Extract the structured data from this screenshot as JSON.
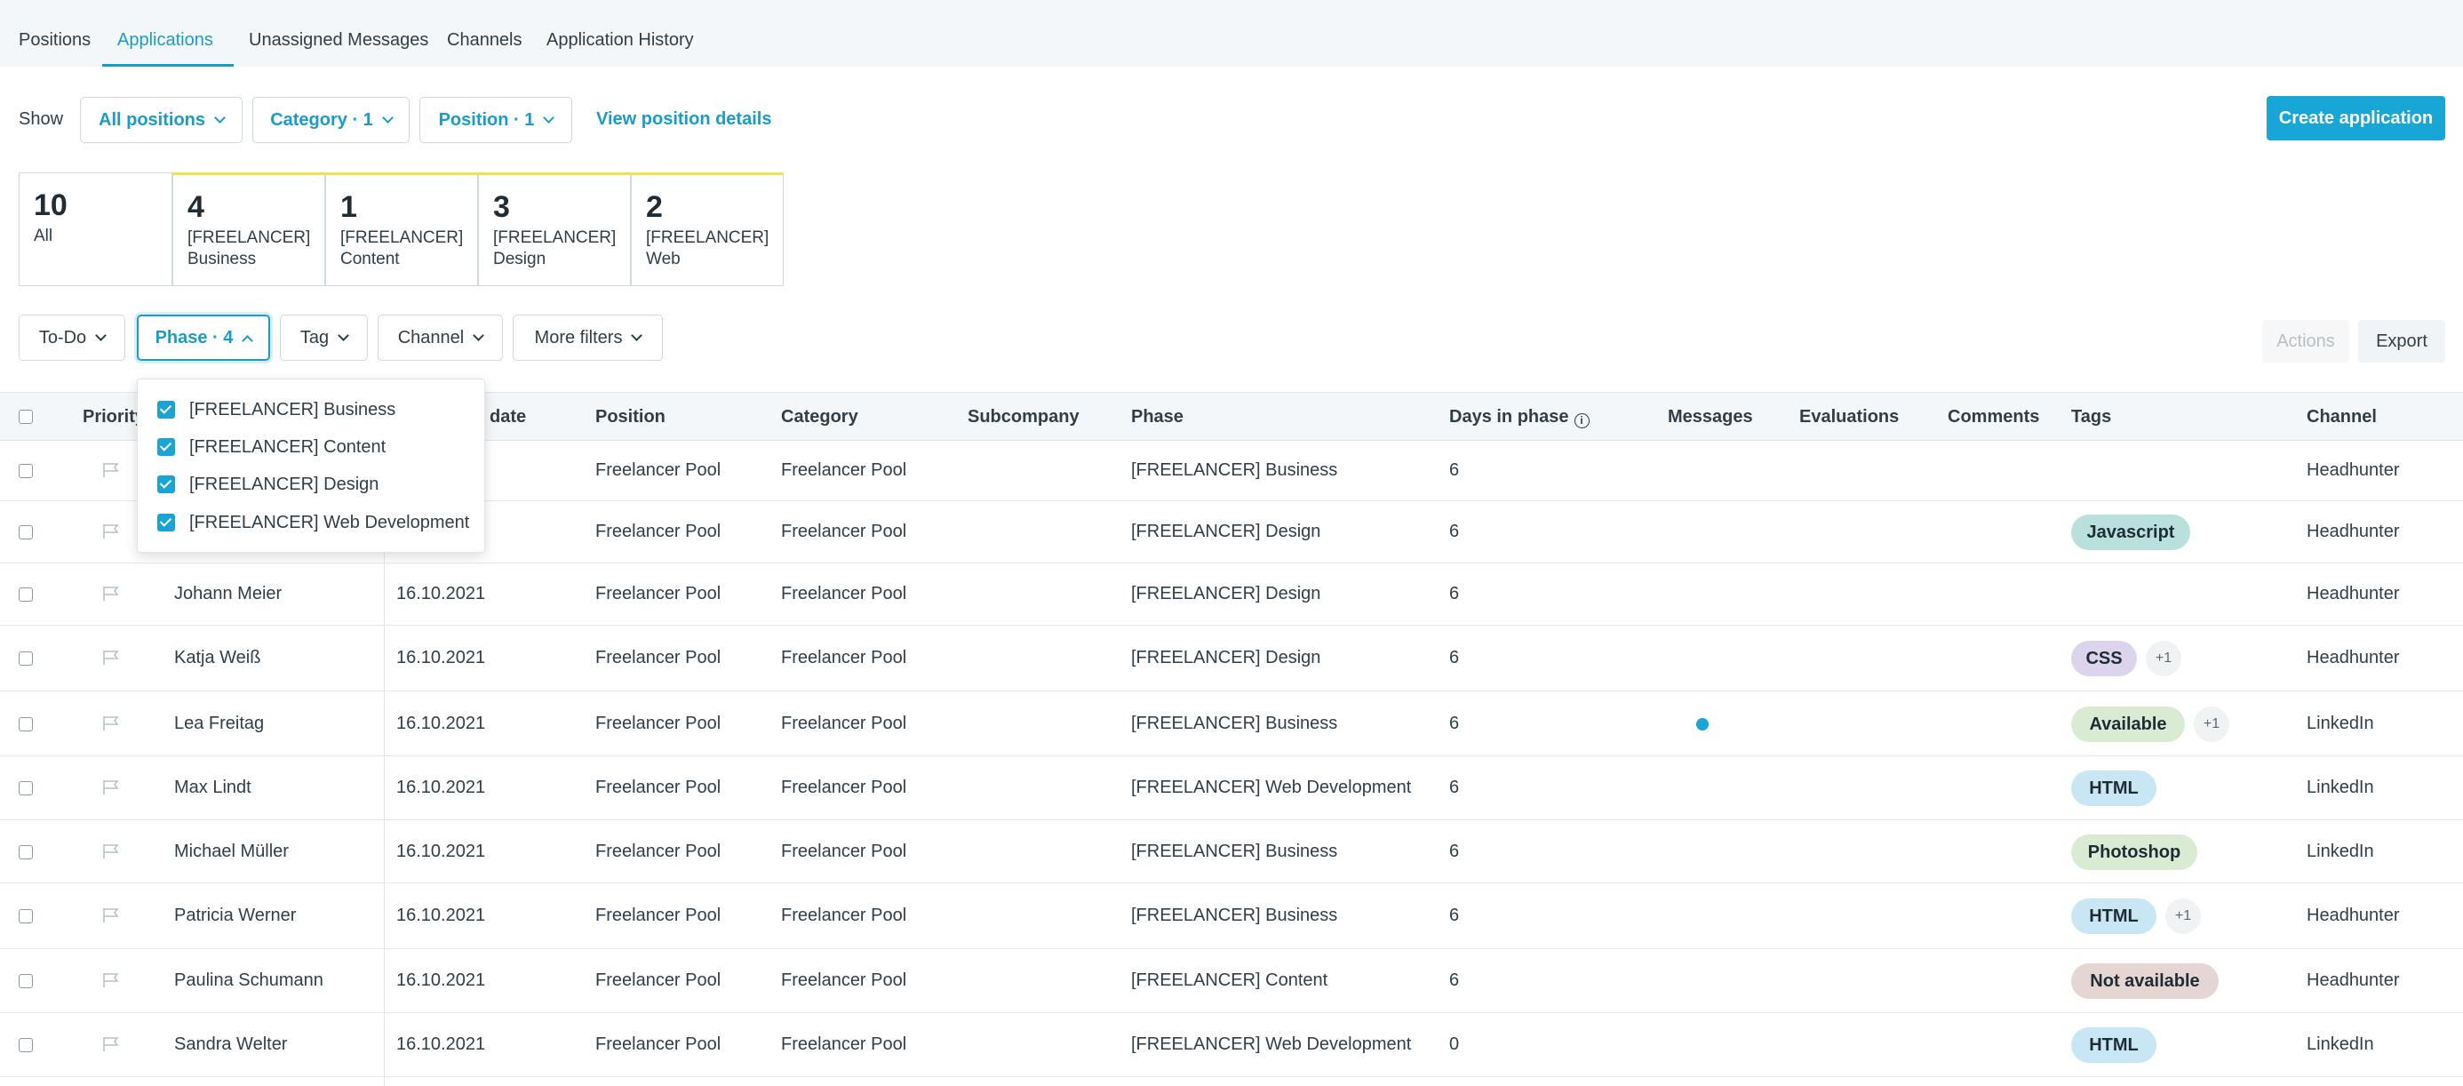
{
  "nav": {
    "tabs": [
      {
        "label": "Positions"
      },
      {
        "label": "Applications"
      },
      {
        "label": "Unassigned Messages"
      },
      {
        "label": "Channels"
      },
      {
        "label": "Application History"
      }
    ]
  },
  "show_bar": {
    "label": "Show",
    "all_positions": "All positions",
    "category": "Category · 1",
    "position": "Position · 1",
    "view_details": "View position details",
    "create": "Create application"
  },
  "cards": [
    {
      "count": "10",
      "line1": "All",
      "line2": ""
    },
    {
      "count": "4",
      "line1": "[FREELANCER]",
      "line2": "Business"
    },
    {
      "count": "1",
      "line1": "[FREELANCER]",
      "line2": "Content"
    },
    {
      "count": "3",
      "line1": "[FREELANCER]",
      "line2": "Design"
    },
    {
      "count": "2",
      "line1": "[FREELANCER]",
      "line2": "Web"
    }
  ],
  "filters": {
    "todo": "To-Do",
    "phase": "Phase · 4",
    "tag": "Tag",
    "channel": "Channel",
    "more": "More filters",
    "actions": "Actions",
    "export": "Export"
  },
  "phase_dropdown": {
    "options": [
      "[FREELANCER] Business",
      "[FREELANCER] Content",
      "[FREELANCER] Design",
      "[FREELANCER] Web Development"
    ]
  },
  "table": {
    "headers": {
      "priority": "Priority",
      "date": "date",
      "position": "Position",
      "category": "Category",
      "subcompany": "Subcompany",
      "phase": "Phase",
      "days": "Days in phase",
      "messages": "Messages",
      "evaluations": "Evaluations",
      "comments": "Comments",
      "tags": "Tags",
      "channel": "Channel"
    },
    "rows": [
      {
        "name": "",
        "date": "",
        "position": "Freelancer Pool",
        "category": "Freelancer Pool",
        "phase": "[FREELANCER] Business",
        "days": "6",
        "tag": "",
        "extra": "",
        "channel": "Headhunter"
      },
      {
        "name": "",
        "date": "",
        "position": "Freelancer Pool",
        "category": "Freelancer Pool",
        "phase": "[FREELANCER] Design",
        "days": "6",
        "tag": "Javascript",
        "extra": "",
        "channel": "Headhunter"
      },
      {
        "name": "Johann Meier",
        "date": "16.10.2021",
        "position": "Freelancer Pool",
        "category": "Freelancer Pool",
        "phase": "[FREELANCER] Design",
        "days": "6",
        "tag": "",
        "extra": "",
        "channel": "Headhunter"
      },
      {
        "name": "Katja Weiß",
        "date": "16.10.2021",
        "position": "Freelancer Pool",
        "category": "Freelancer Pool",
        "phase": "[FREELANCER] Design",
        "days": "6",
        "tag": "CSS",
        "extra": "+1",
        "channel": "Headhunter"
      },
      {
        "name": "Lea Freitag",
        "date": "16.10.2021",
        "position": "Freelancer Pool",
        "category": "Freelancer Pool",
        "phase": "[FREELANCER] Business",
        "days": "6",
        "tag": "Available",
        "extra": "+1",
        "channel": "LinkedIn"
      },
      {
        "name": "Max Lindt",
        "date": "16.10.2021",
        "position": "Freelancer Pool",
        "category": "Freelancer Pool",
        "phase": "[FREELANCER] Web Development",
        "days": "6",
        "tag": "HTML",
        "extra": "",
        "channel": "LinkedIn"
      },
      {
        "name": "Michael Müller",
        "date": "16.10.2021",
        "position": "Freelancer Pool",
        "category": "Freelancer Pool",
        "phase": "[FREELANCER] Business",
        "days": "6",
        "tag": "Photoshop",
        "extra": "",
        "channel": "LinkedIn"
      },
      {
        "name": "Patricia Werner",
        "date": "16.10.2021",
        "position": "Freelancer Pool",
        "category": "Freelancer Pool",
        "phase": "[FREELANCER] Business",
        "days": "6",
        "tag": "HTML",
        "extra": "+1",
        "channel": "Headhunter"
      },
      {
        "name": "Paulina Schumann",
        "date": "16.10.2021",
        "position": "Freelancer Pool",
        "category": "Freelancer Pool",
        "phase": "[FREELANCER] Content",
        "days": "6",
        "tag": "Not available",
        "extra": "",
        "channel": "Headhunter"
      },
      {
        "name": "Sandra Welter",
        "date": "16.10.2021",
        "position": "Freelancer Pool",
        "category": "Freelancer Pool",
        "phase": "[FREELANCER] Web Development",
        "days": "0",
        "tag": "HTML",
        "extra": "",
        "channel": "LinkedIn"
      }
    ]
  },
  "colors": {
    "accent": "#1a9cc9",
    "tag_javascript": "#b9e0dc",
    "tag_css": "#dcd3ec",
    "tag_available": "#d9ecd3",
    "tag_html": "#c9e6f5",
    "tag_photoshop": "#d9ecd3",
    "tag_not_available": "#e6d6d3"
  }
}
